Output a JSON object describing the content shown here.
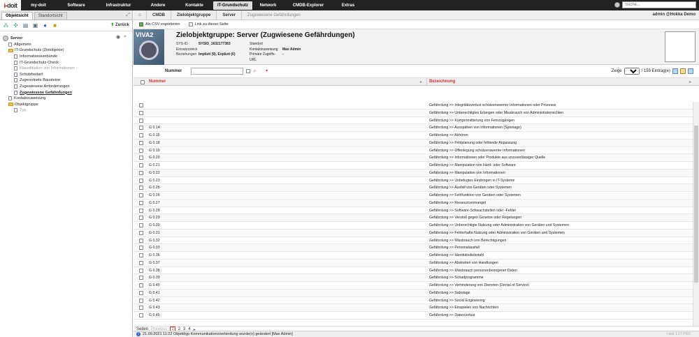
{
  "nav": {
    "logo_a": "i-",
    "logo_b": "doit",
    "items": [
      "my-doit",
      "Software",
      "Infrastruktur",
      "Andere",
      "Kontakte",
      "IT-Grundschutz",
      "Network",
      "CMDB-Explorer",
      "Extras"
    ],
    "search_placeholder": "Suche..."
  },
  "left": {
    "tab1": "Objektsicht",
    "tab2": "Standortsicht",
    "back": "Zurück",
    "tree": [
      {
        "label": "Server",
        "type": "srv",
        "indent": 0,
        "style": "bold"
      },
      {
        "label": "Allgemein",
        "type": "doc",
        "indent": 1,
        "style": ""
      },
      {
        "label": "IT-Grundschutz (Zielobjekte)",
        "type": "folder",
        "indent": 1,
        "style": ""
      },
      {
        "label": "Informationsverbünde",
        "type": "doc",
        "indent": 2,
        "style": ""
      },
      {
        "label": "IT-Grundschutz-Check",
        "type": "doc",
        "indent": 2,
        "style": ""
      },
      {
        "label": "Klassifikation von Informationen",
        "type": "doc",
        "indent": 2,
        "style": "grey"
      },
      {
        "label": "Schutzbedarf",
        "type": "doc",
        "indent": 2,
        "style": ""
      },
      {
        "label": "Zugeordnete Bausteine",
        "type": "doc",
        "indent": 2,
        "style": ""
      },
      {
        "label": "Zugewiesene Anforderungen",
        "type": "doc",
        "indent": 2,
        "style": ""
      },
      {
        "label": "Zugewiesene Gefährdungen",
        "type": "doc",
        "indent": 2,
        "style": "underline"
      },
      {
        "label": "Kontaktzuweisung",
        "type": "doc",
        "indent": 1,
        "style": ""
      },
      {
        "label": "Objektgruppe",
        "type": "folder",
        "indent": 1,
        "style": ""
      },
      {
        "label": "Typ",
        "type": "doc",
        "indent": 2,
        "style": "grey"
      }
    ]
  },
  "breadcrumb": {
    "items": [
      "CMDB",
      "Zielobjektgruppe",
      "Server",
      "Zugewiesene Gefährdungen"
    ],
    "user": "admin  @Hokka Demo"
  },
  "actions": {
    "csv": "Als CSV exportieren",
    "link": "Link zu dieser Seite"
  },
  "header": {
    "logo_text": "VIVA2",
    "title": "Zielobjektgruppe: Server (Zugwiesene Gefährdungen)",
    "sysid_k": "SYS-ID",
    "sysid_v": "SYSID_1632177383",
    "einsatz_k": "Einsatzzweck",
    "bez_k": "Beziehungen",
    "bez_v": "Implizit (9), Explizit (0)",
    "standort_k": "Standort",
    "kontakt_k": "Kontaktzuweisung",
    "kontakt_v": "Max Admin",
    "url_k": "Primäre Zugriffs-URL",
    "url_v": "-"
  },
  "filter": {
    "label": "Nummer",
    "zeige": "Zeige",
    "per_page": "50",
    "count": "/ 159 Eintrag(e)"
  },
  "table": {
    "col_num": "Nummer",
    "col_bez": "Bezeichnung",
    "rows": [
      {
        "n": "",
        "b": "Gefährdung >> Integritätsverlust schützenswerter Informationen oder Prozesse"
      },
      {
        "n": "",
        "b": "Gefährdung >> Unberechtigtes Erlangen oder Missbrauch von Administratorrechten"
      },
      {
        "n": "",
        "b": "Gefährdung >> Kompromittierung von Fernzugängen"
      },
      {
        "n": "G 0.14",
        "b": "Gefährdung >> Ausspähen von Informationen (Spionage)"
      },
      {
        "n": "G 0.15",
        "b": "Gefährdung >> Abhören"
      },
      {
        "n": "G 0.18",
        "b": "Gefährdung >> Fehlplanung oder fehlende Anpassung"
      },
      {
        "n": "G 0.19",
        "b": "Gefährdung >> Offenlegung schützenswerter Informationen"
      },
      {
        "n": "G 0.20",
        "b": "Gefährdung >> Informationen oder Produkte aus unzuverlässiger Quelle"
      },
      {
        "n": "G 0.21",
        "b": "Gefährdung >> Manipulation von Hard- oder Software"
      },
      {
        "n": "G 0.22",
        "b": "Gefährdung >> Manipulation von Informationen"
      },
      {
        "n": "G 0.23",
        "b": "Gefährdung >> Unbefugtes Eindringen in IT-Systeme"
      },
      {
        "n": "G 0.25",
        "b": "Gefährdung >> Ausfall von Geräten oder Systemen"
      },
      {
        "n": "G 0.26",
        "b": "Gefährdung >> Fehlfunktion von Geräten oder Systemen"
      },
      {
        "n": "G 0.27",
        "b": "Gefährdung >> Ressourcenmangel"
      },
      {
        "n": "G 0.28",
        "b": "Gefährdung >> Software-Schwachstellen oder -Fehler"
      },
      {
        "n": "G 0.29",
        "b": "Gefährdung >> Verstoß gegen Gesetze oder Regelungen"
      },
      {
        "n": "G 0.30",
        "b": "Gefährdung >> Unberechtigte Nutzung oder Administration von Geräten und Systemen"
      },
      {
        "n": "G 0.31",
        "b": "Gefährdung >> Fehlerhafte Nutzung oder Administration von Geräten und Systemen"
      },
      {
        "n": "G 0.32",
        "b": "Gefährdung >> Missbrauch von Berechtigungen"
      },
      {
        "n": "G 0.33",
        "b": "Gefährdung >> Personalausfall"
      },
      {
        "n": "G 0.36",
        "b": "Gefährdung >> Identitätsdiebstahl"
      },
      {
        "n": "G 0.37",
        "b": "Gefährdung >> Abstreiten von Handlungen"
      },
      {
        "n": "G 0.38",
        "b": "Gefährdung >> Missbrauch personenbezogener Daten"
      },
      {
        "n": "G 0.39",
        "b": "Gefährdung >> Schadprogramme"
      },
      {
        "n": "G 0.40",
        "b": "Gefährdung >> Verhinderung von Diensten (Denial of Service)"
      },
      {
        "n": "G 0.41",
        "b": "Gefährdung >> Sabotage"
      },
      {
        "n": "G 0.42",
        "b": "Gefährdung >> Social Engineering"
      },
      {
        "n": "G 0.43",
        "b": "Gefährdung >> Einspielen von Nachrichten"
      },
      {
        "n": "G 0.45",
        "b": "Gefährdung >> Datenverlust"
      }
    ]
  },
  "pager": {
    "label": "Seiten",
    "prev": "Previous",
    "pages": [
      "1",
      "2",
      "3",
      "4"
    ],
    "next": "▸",
    "version": "i-doit 1.17 PRO"
  },
  "status": {
    "text": "21.09.2021 11:22 Objekttyp Kommunikationsverbindung wurde(n) geändert [Max Admin]"
  }
}
